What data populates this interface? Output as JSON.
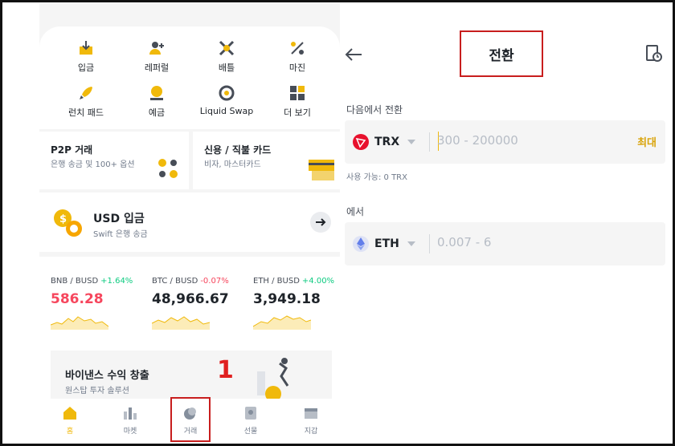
{
  "left": {
    "menu": [
      {
        "label": "입금",
        "icon": "deposit-icon"
      },
      {
        "label": "레퍼럴",
        "icon": "referral-icon"
      },
      {
        "label": "배틀",
        "icon": "battle-icon"
      },
      {
        "label": "마진",
        "icon": "margin-icon"
      },
      {
        "label": "런치 패드",
        "icon": "rocket-icon"
      },
      {
        "label": "예금",
        "icon": "savings-icon"
      },
      {
        "label": "Liquid Swap",
        "icon": "swap-icon"
      },
      {
        "label": "더 보기",
        "icon": "more-icon"
      }
    ],
    "p2p": {
      "title": "P2P 거래",
      "sub": "은행 송금 및 100+ 옵션"
    },
    "card_promo": {
      "title": "신용 / 직불 카드",
      "sub": "비자, 마스터카드"
    },
    "usd": {
      "title": "USD 입금",
      "sub": "Swift 은행 송금"
    },
    "tickers": [
      {
        "pair": "BNB / BUSD",
        "change": "+1.64%",
        "price": "586.28",
        "change_color": "#0ecb81",
        "price_color": "#f6465d"
      },
      {
        "pair": "BTC / BUSD",
        "change": "-0.07%",
        "price": "48,966.67",
        "change_color": "#f6465d",
        "price_color": "#1e2329"
      },
      {
        "pair": "ETH / BUSD",
        "change": "+4.00%",
        "price": "3,949.18",
        "change_color": "#0ecb81",
        "price_color": "#1e2329"
      }
    ],
    "promo": {
      "title": "바이낸스 수익 창출",
      "sub": "원스탑 투자 솔루션"
    },
    "step_number": "1",
    "tabs": [
      {
        "label": "홈",
        "icon": "home-icon",
        "active": true
      },
      {
        "label": "마켓",
        "icon": "market-icon",
        "active": false
      },
      {
        "label": "거래",
        "icon": "trade-icon",
        "active": false
      },
      {
        "label": "선물",
        "icon": "futures-icon",
        "active": false
      },
      {
        "label": "지갑",
        "icon": "wallet-icon",
        "active": false
      }
    ]
  },
  "right": {
    "title": "전환",
    "from_label": "다음에서 전환",
    "from": {
      "coin": "TRX",
      "placeholder": "300 - 200000",
      "max_label": "최대",
      "available": "사용 가능: 0 TRX"
    },
    "to_label": "에서",
    "to": {
      "coin": "ETH",
      "placeholder": "0.007 - 6"
    }
  },
  "colors": {
    "accent": "#f0b90b",
    "highlight_box": "#c81e1e",
    "up": "#0ecb81",
    "down": "#f6465d"
  }
}
